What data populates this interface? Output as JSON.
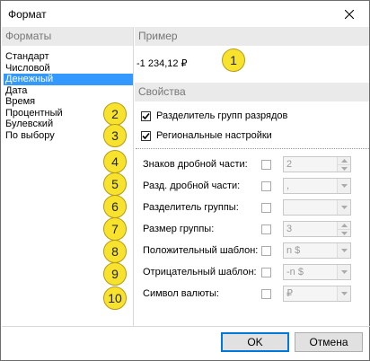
{
  "window": {
    "title": "Формат"
  },
  "formats": {
    "header": "Форматы",
    "items": [
      "Стандарт",
      "Числовой",
      "Денежный",
      "Дата",
      "Время",
      "Процентный",
      "Булевский",
      "По выбору"
    ],
    "selected_index": 2
  },
  "sample": {
    "header": "Пример",
    "value": "-1 234,12 ₽"
  },
  "properties": {
    "header": "Свойства",
    "group_separator_label": "Разделитель групп разрядов",
    "group_separator_checked": true,
    "regional_label": "Региональные настройки",
    "regional_checked": true,
    "rows": [
      {
        "label": "Знаков дробной части:",
        "value": "2",
        "control": "spin"
      },
      {
        "label": "Разд. дробной части:",
        "value": ",",
        "control": "dropdown"
      },
      {
        "label": "Разделитель группы:",
        "value": "",
        "control": "dropdown"
      },
      {
        "label": "Размер группы:",
        "value": "3",
        "control": "spin"
      },
      {
        "label": "Положительный шаблон:",
        "value": "n $",
        "control": "dropdown"
      },
      {
        "label": "Отрицательный шаблон:",
        "value": "-n $",
        "control": "dropdown"
      },
      {
        "label": "Символ валюты:",
        "value": "₽",
        "control": "dropdown"
      }
    ]
  },
  "callouts": [
    "1",
    "2",
    "3",
    "4",
    "5",
    "6",
    "7",
    "8",
    "9",
    "10"
  ],
  "buttons": {
    "ok": "OK",
    "cancel": "Отмена"
  },
  "colors": {
    "selection": "#3399ff",
    "callout": "#f7e32e",
    "header_bg": "#eaeaea"
  }
}
